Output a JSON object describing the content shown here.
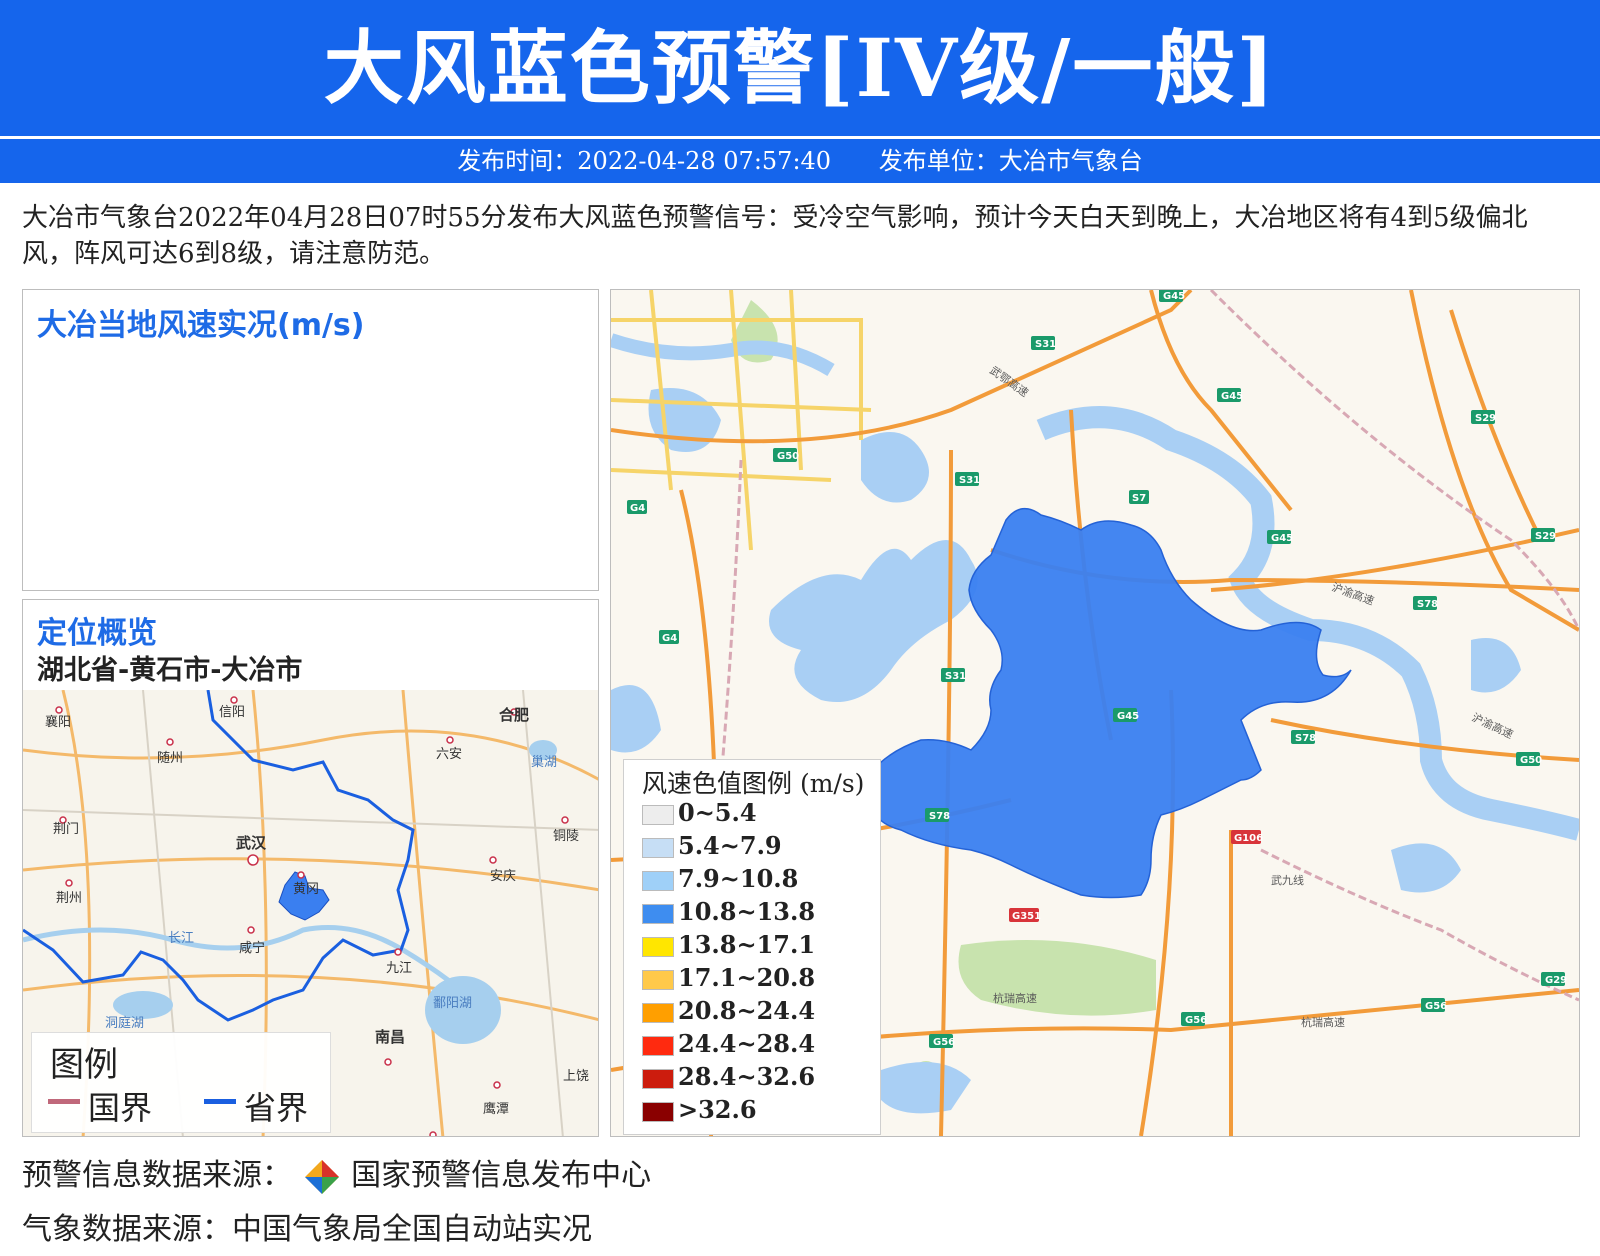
{
  "header": {
    "title": "大风蓝色预警[IV级/一般]",
    "publish_time": "发布时间：2022-04-28 07:57:40",
    "publish_unit": "发布单位：大冶市气象台"
  },
  "description": "大冶市气象台2022年04月28日07时55分发布大风蓝色预警信号：受冷空气影响，预计今天白天到晚上，大冶地区将有4到5级偏北风，阵风可达6到8级，请注意防范。",
  "wind_panel": {
    "title": "大冶当地风速实况(m/s)"
  },
  "location_panel": {
    "title": "定位概览",
    "subtitle": "湖北省-黄石市-大冶市",
    "cities": [
      "襄阳",
      "信阳",
      "合肥",
      "随州",
      "六安",
      "巢湖",
      "荆门",
      "武汉",
      "铜陵",
      "黄冈",
      "安庆",
      "荆州",
      "长江",
      "咸宁",
      "九江",
      "洞庭湖",
      "鄱阳湖",
      "南昌",
      "上饶",
      "鹰潭"
    ],
    "legend": {
      "title": "图例",
      "national": "国界",
      "provincial": "省界"
    },
    "colors": {
      "national": "#c0687a",
      "provincial": "#1a5fe0"
    }
  },
  "main_map": {
    "road_labels": [
      "G45",
      "S31",
      "G45",
      "S29",
      "G50",
      "S31",
      "S7",
      "G4",
      "G45",
      "S29",
      "S78",
      "G4",
      "S31",
      "G45",
      "S78",
      "G50",
      "S78",
      "G106",
      "G351",
      "G56",
      "G56",
      "G56",
      "G29"
    ],
    "road_names": [
      "武鄂高速",
      "沪渝高速",
      "沪渝高速",
      "武九线",
      "杭瑞高速",
      "杭瑞高速"
    ],
    "region_color": "#3a7ff0",
    "legend": {
      "title": "风速色值图例 (m/s)",
      "items": [
        {
          "label": "0~5.4",
          "color": "#ededed"
        },
        {
          "label": "5.4~7.9",
          "color": "#c6def5"
        },
        {
          "label": "7.9~10.8",
          "color": "#9fd0f8"
        },
        {
          "label": "10.8~13.8",
          "color": "#3e8df0"
        },
        {
          "label": "13.8~17.1",
          "color": "#ffe600"
        },
        {
          "label": "17.1~20.8",
          "color": "#ffc94a"
        },
        {
          "label": "20.8~24.4",
          "color": "#ff9f00"
        },
        {
          "label": "24.4~28.4",
          "color": "#ff2a0f"
        },
        {
          "label": "28.4~32.6",
          "color": "#cc1c0d"
        },
        {
          "label": ">32.6",
          "color": "#8a0000"
        }
      ]
    }
  },
  "footer": {
    "warning_source": "预警信息数据来源：",
    "warning_org": "国家预警信息发布中心",
    "weather_source": "气象数据来源：中国气象局全国自动站实况"
  }
}
